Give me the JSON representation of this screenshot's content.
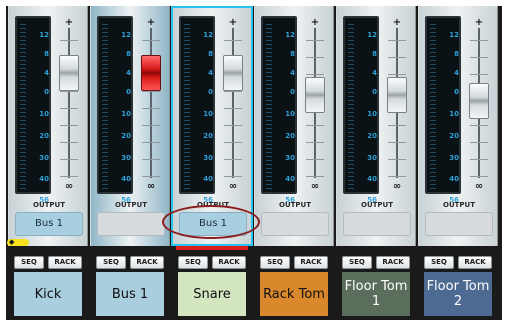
{
  "mixer": {
    "meter_labels": [
      "12",
      "8",
      "4",
      "0",
      "10",
      "20",
      "30",
      "40",
      "56"
    ],
    "channels": [
      {
        "name": "Kick",
        "output_label": "OUTPUT",
        "bus": "Bus 1",
        "seq": "SEQ",
        "rack": "RACK",
        "fader_level": 0.25,
        "fader_style": "silver",
        "strip_color": "#c9d2d6",
        "name_bg": "#a9cfdf",
        "name_color": "#111111",
        "selected": false
      },
      {
        "name": "Bus 1",
        "output_label": "OUTPUT",
        "bus": "",
        "seq": "SEQ",
        "rack": "RACK",
        "fader_level": 0.25,
        "fader_style": "red",
        "strip_color": "#8fb6c7",
        "name_bg": "#a9cfdf",
        "name_color": "#111111",
        "selected": false
      },
      {
        "name": "Snare",
        "output_label": "OUTPUT",
        "bus": "Bus 1",
        "seq": "SEQ",
        "rack": "RACK",
        "fader_level": 0.25,
        "fader_style": "silver",
        "strip_color": "#c9d2d6",
        "name_bg": "#d3e6c0",
        "name_color": "#111111",
        "selected": true
      },
      {
        "name": "Rack Tom",
        "output_label": "OUTPUT",
        "bus": "",
        "seq": "SEQ",
        "rack": "RACK",
        "fader_level": 0.45,
        "fader_style": "silver",
        "strip_color": "#c9d2d6",
        "name_bg": "#d9892c",
        "name_color": "#111111",
        "selected": false
      },
      {
        "name": "Floor Tom 1",
        "output_label": "OUTPUT",
        "bus": "",
        "seq": "SEQ",
        "rack": "RACK",
        "fader_level": 0.45,
        "fader_style": "silver",
        "strip_color": "#c9d2d6",
        "name_bg": "#5b6e5b",
        "name_color": "#ffffff",
        "selected": false
      },
      {
        "name": "Floor Tom 2",
        "output_label": "OUTPUT",
        "bus": "",
        "seq": "SEQ",
        "rack": "RACK",
        "fader_level": 0.5,
        "fader_style": "silver",
        "strip_color": "#c9d2d6",
        "name_bg": "#4c6a92",
        "name_color": "#ffffff",
        "selected": false
      }
    ],
    "fader_top_symbol": "+",
    "fader_bottom_symbol": "∞"
  }
}
